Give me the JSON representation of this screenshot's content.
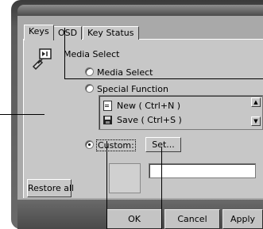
{
  "tabs": [
    {
      "label": "Keys",
      "active": true
    },
    {
      "label": "OSD",
      "active": false
    },
    {
      "label": "Key Status",
      "active": false
    }
  ],
  "media_select_label": "Media Select",
  "options": {
    "media_select": "Media Select",
    "special_function": "Special Function",
    "custom": "Custom:"
  },
  "selected_option": "custom",
  "special_function_list": [
    {
      "icon": "new-document-icon",
      "label": "New ( Ctrl+N )"
    },
    {
      "icon": "save-floppy-icon",
      "label": "Save ( Ctrl+S )"
    }
  ],
  "set_button": "Set...",
  "custom_value": "",
  "restore_all_button": "Restore all",
  "footer_buttons": {
    "ok": "OK",
    "cancel": "Cancel",
    "apply": "Apply"
  }
}
